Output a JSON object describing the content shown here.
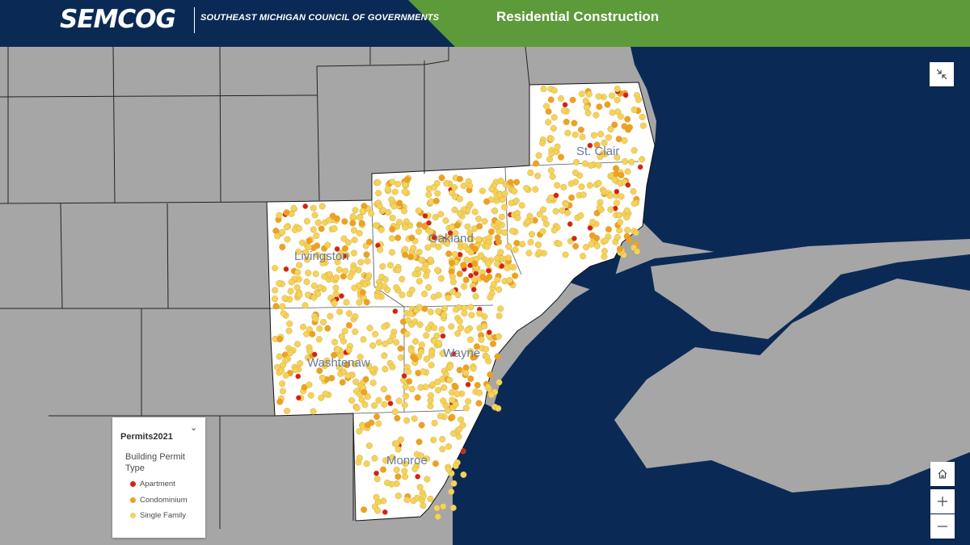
{
  "header": {
    "logo": "SEMCOG",
    "org_name": "SOUTHEAST MICHIGAN COUNCIL OF GOVERNMENTS",
    "title": "Residential Construction"
  },
  "map": {
    "county_labels": [
      "St. Clair",
      "Oakland",
      "Livingston",
      "Washtenaw",
      "Wayne",
      "Monroe"
    ],
    "colors": {
      "land": "#a6a6a6",
      "water": "#0a2a55",
      "region": "#ffffff"
    }
  },
  "controls": {
    "collapse_icon": "collapse-icon",
    "home_icon": "home-icon",
    "zoom_in_icon": "plus-icon",
    "zoom_out_icon": "minus-icon"
  },
  "legend": {
    "layer_title": "Permits2021",
    "subtitle": "Building Permit Type",
    "items": [
      {
        "label": "Apartment",
        "color": "#d81e1e"
      },
      {
        "label": "Condominium",
        "color": "#f0a020"
      },
      {
        "label": "Single Family",
        "color": "#f5d35a"
      }
    ]
  }
}
